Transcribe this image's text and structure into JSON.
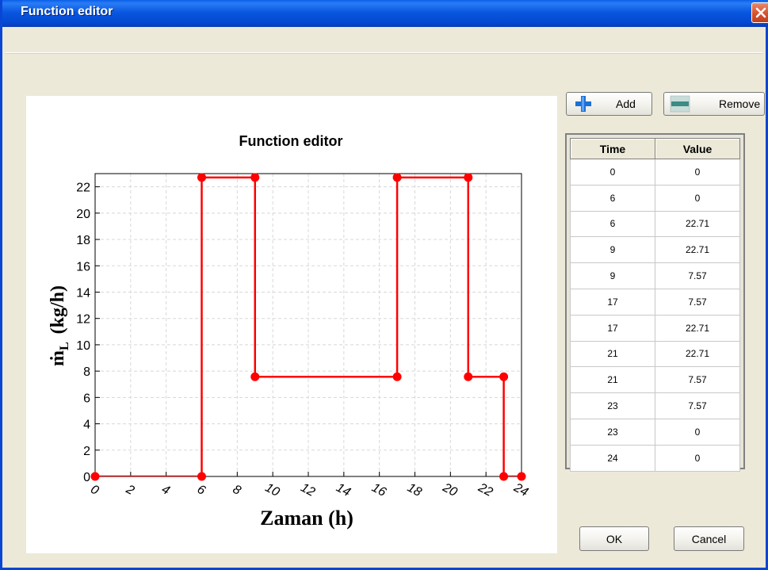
{
  "window": {
    "title": "Function editor"
  },
  "toolbar": {
    "add_label": "Add",
    "remove_label": "Remove"
  },
  "table": {
    "headers": [
      "Time",
      "Value"
    ],
    "rows": [
      [
        "0",
        "0"
      ],
      [
        "6",
        "0"
      ],
      [
        "6",
        "22.71"
      ],
      [
        "9",
        "22.71"
      ],
      [
        "9",
        "7.57"
      ],
      [
        "17",
        "7.57"
      ],
      [
        "17",
        "22.71"
      ],
      [
        "21",
        "22.71"
      ],
      [
        "21",
        "7.57"
      ],
      [
        "23",
        "7.57"
      ],
      [
        "23",
        "0"
      ],
      [
        "24",
        "0"
      ]
    ]
  },
  "footer": {
    "ok_label": "OK",
    "cancel_label": "Cancel"
  },
  "colors": {
    "series": "#ff0000",
    "titlebar": "#0a5fe8"
  },
  "chart_data": {
    "type": "line",
    "title": "Function editor",
    "xlabel": "Zaman (h)",
    "ylabel": "(kg/h)",
    "ylabel_symbol": "ṁ",
    "ylabel_subscript": "L",
    "xlim": [
      0,
      24
    ],
    "ylim": [
      0,
      23
    ],
    "xticks": [
      0,
      2,
      4,
      6,
      8,
      10,
      12,
      14,
      16,
      18,
      20,
      22,
      24
    ],
    "yticks": [
      0,
      2,
      4,
      6,
      8,
      10,
      12,
      14,
      16,
      18,
      20,
      22
    ],
    "grid": true,
    "series": [
      {
        "x": [
          0,
          6,
          6,
          9,
          9,
          17,
          17,
          21,
          21,
          23,
          23,
          24
        ],
        "y": [
          0,
          0,
          22.71,
          22.71,
          7.57,
          7.57,
          22.71,
          22.71,
          7.57,
          7.57,
          0,
          0
        ]
      }
    ]
  }
}
